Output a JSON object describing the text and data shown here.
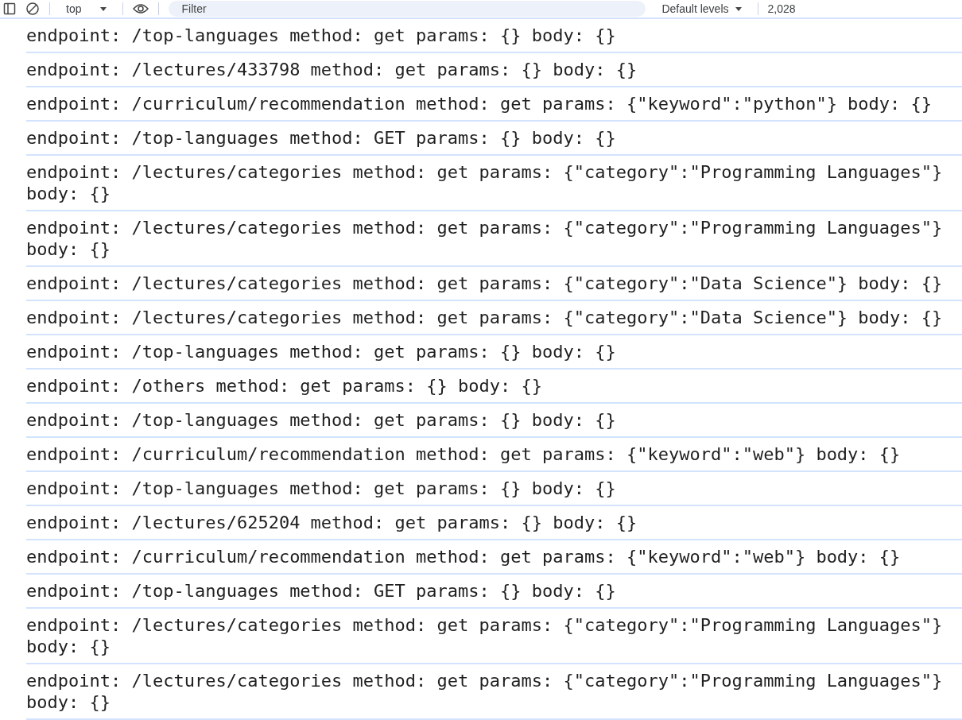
{
  "toolbar": {
    "context": "top",
    "filter": {
      "placeholder": "Filter"
    },
    "levels": "Default levels",
    "count": "2,028"
  },
  "messages": [
    "endpoint: /top-languages method: get params: {} body: {}",
    "endpoint: /lectures/433798 method: get params: {} body: {}",
    "endpoint: /curriculum/recommendation method: get params: {\"keyword\":\"python\"} body: {}",
    "endpoint: /top-languages method: GET params: {} body: {}",
    "endpoint: /lectures/categories method: get params: {\"category\":\"Programming Languages\"} body: {}",
    "endpoint: /lectures/categories method: get params: {\"category\":\"Programming Languages\"} body: {}",
    "endpoint: /lectures/categories method: get params: {\"category\":\"Data Science\"} body: {}",
    "endpoint: /lectures/categories method: get params: {\"category\":\"Data Science\"} body: {}",
    "endpoint: /top-languages method: get params: {} body: {}",
    "endpoint: /others method: get params: {} body: {}",
    "endpoint: /top-languages method: get params: {} body: {}",
    "endpoint: /curriculum/recommendation method: get params: {\"keyword\":\"web\"} body: {}",
    "endpoint: /top-languages method: get params: {} body: {}",
    "endpoint: /lectures/625204 method: get params: {} body: {}",
    "endpoint: /curriculum/recommendation method: get params: {\"keyword\":\"web\"} body: {}",
    "endpoint: /top-languages method: GET params: {} body: {}",
    "endpoint: /lectures/categories method: get params: {\"category\":\"Programming Languages\"} body: {}",
    "endpoint: /lectures/categories method: get params: {\"category\":\"Programming Languages\"} body: {}"
  ]
}
